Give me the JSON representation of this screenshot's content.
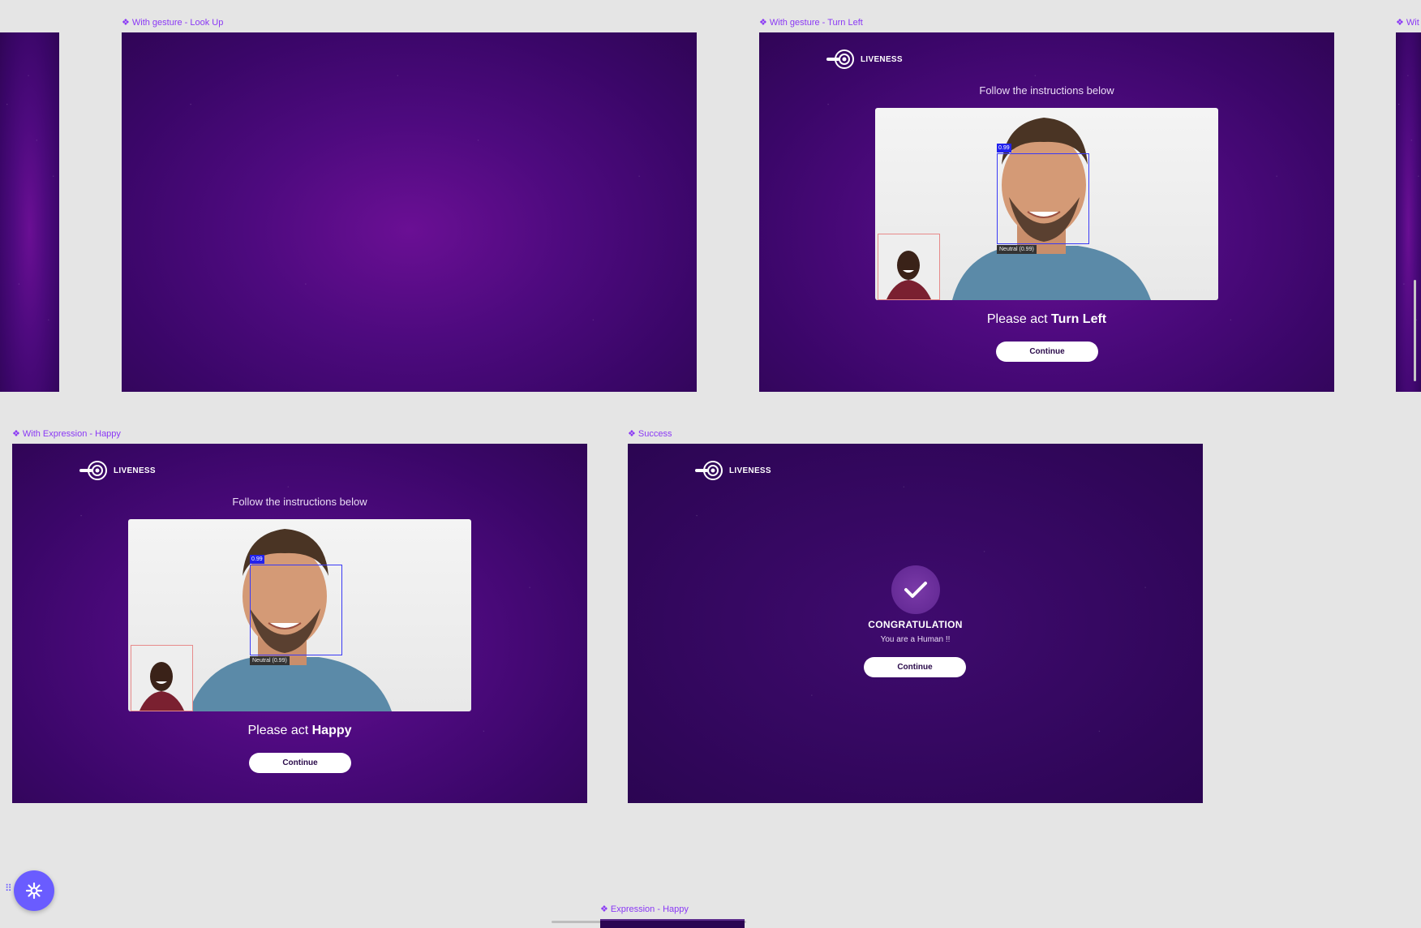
{
  "frames": {
    "look_up": {
      "label": "With gesture - Look Up"
    },
    "turn_left": {
      "label": "With gesture - Turn Left",
      "logo_text": "LIVENESS",
      "instruction": "Follow the instructions below",
      "score": "0.99",
      "emotion": "Neutral (0.99)",
      "act_prefix": "Please act ",
      "act_action": "Turn Left",
      "button": "Continue"
    },
    "happy": {
      "label": "With Expression - Happy",
      "logo_text": "LIVENESS",
      "instruction": "Follow the instructions below",
      "score": "0.99",
      "emotion": "Neutral (0.99)",
      "act_prefix": "Please act ",
      "act_action": "Happy",
      "button": "Continue"
    },
    "success": {
      "label": "Success",
      "logo_text": "LIVENESS",
      "title": "CONGRATULATION",
      "subtitle": "You are a Human !!",
      "button": "Continue"
    },
    "next_right": {
      "label": "Wit"
    },
    "bottom": {
      "label": "Expression - Happy"
    }
  },
  "icons": {
    "frame_marker": "component-diamond-icon",
    "logo": "target-logo-icon",
    "success": "check-icon",
    "fab": "sparkle-icon"
  },
  "colors": {
    "canvas": "#e5e5e5",
    "label": "#8a38f5",
    "frame_bg": "#4d0a7e",
    "fab": "#6a5cff"
  }
}
